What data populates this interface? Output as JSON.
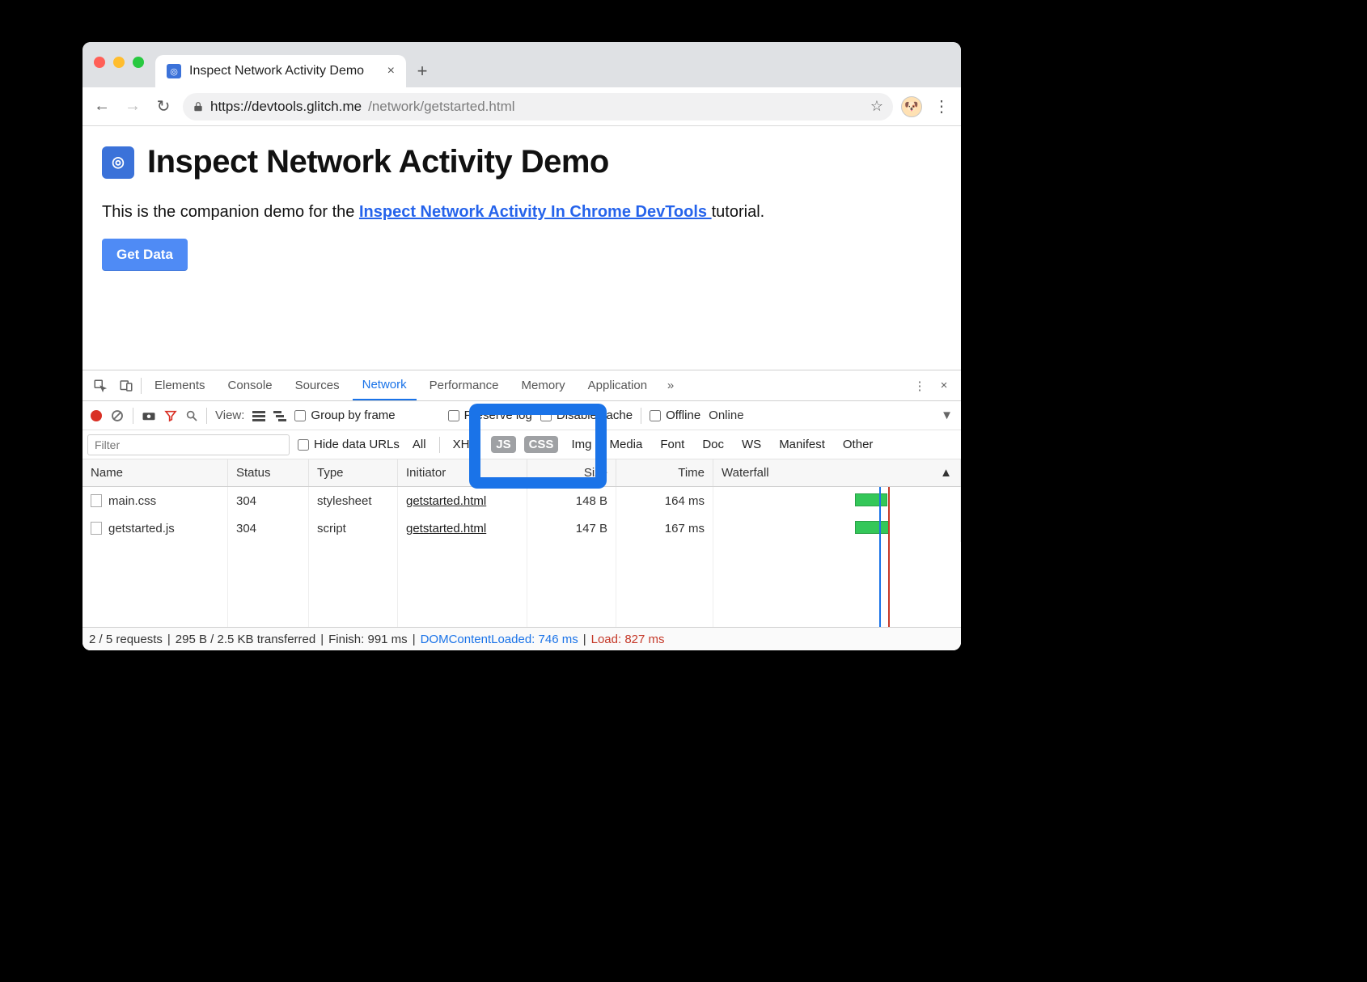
{
  "tab": {
    "title": "Inspect Network Activity Demo",
    "close": "×",
    "newtab": "+"
  },
  "toolbar": {
    "back": "←",
    "forward": "→",
    "reload": "↻",
    "url_host": "https://devtools.glitch.me",
    "url_path": "/network/getstarted.html",
    "star": "☆",
    "menu": "⋮"
  },
  "page": {
    "title": "Inspect Network Activity Demo",
    "intro_pre": "This is the companion demo for the ",
    "intro_link": "Inspect Network Activity In Chrome DevTools ",
    "intro_post": "tutorial.",
    "button": "Get Data"
  },
  "devtools": {
    "tabs": [
      "Elements",
      "Console",
      "Sources",
      "Network",
      "Performance",
      "Memory",
      "Application"
    ],
    "active_tab": "Network",
    "overflow": "»",
    "menu": "⋮",
    "close": "×"
  },
  "network": {
    "view_label": "View:",
    "group_by_frame": "Group by frame",
    "preserve_log": "Preserve log",
    "disable_cache": "Disable cache",
    "offline": "Offline",
    "online": "Online",
    "throttle_arrow": "▼",
    "filter_placeholder": "Filter",
    "hide_data_urls": "Hide data URLs",
    "types": [
      "All",
      "XHR",
      "JS",
      "CSS",
      "Img",
      "Media",
      "Font",
      "Doc",
      "WS",
      "Manifest",
      "Other"
    ],
    "selected_types": [
      "JS",
      "CSS"
    ],
    "columns": [
      "Name",
      "Status",
      "Type",
      "Initiator",
      "Size",
      "Time",
      "Waterfall"
    ],
    "rows": [
      {
        "name": "main.css",
        "status": "304",
        "type": "stylesheet",
        "initiator": "getstarted.html",
        "size": "148 B",
        "time": "164 ms"
      },
      {
        "name": "getstarted.js",
        "status": "304",
        "type": "script",
        "initiator": "getstarted.html",
        "size": "147 B",
        "time": "167 ms"
      }
    ],
    "status": {
      "requests": "2 / 5 requests",
      "transferred": "295 B / 2.5 KB transferred",
      "finish": "Finish: 991 ms",
      "dcl": "DOMContentLoaded: 746 ms",
      "load": "Load: 827 ms"
    }
  }
}
